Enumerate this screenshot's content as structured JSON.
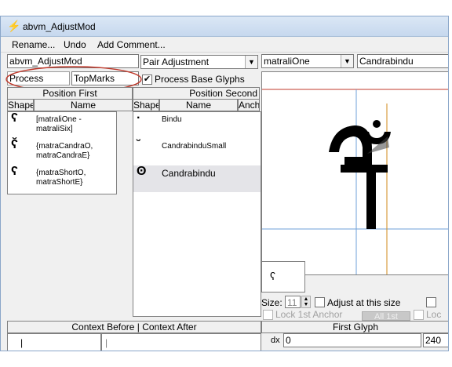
{
  "window": {
    "title": "abvm_AdjustMod",
    "icon": "lightning-icon"
  },
  "menu": {
    "items": [
      "Rename...",
      "Undo",
      "Add Comment..."
    ]
  },
  "left_panel": {
    "name_field": "abvm_AdjustMod",
    "process_label": "Process",
    "process_value": "TopMarks",
    "adjustment_type": "Pair Adjustment",
    "process_base_glyphs_label": "Process Base Glyphs",
    "process_base_glyphs_checked": true
  },
  "position_first": {
    "title": "Position First",
    "columns": [
      "Shape",
      "Name"
    ],
    "rows": [
      {
        "glyph": "ʕ",
        "name": "[matraliOne - matraliSix]"
      },
      {
        "glyph": "ʕ̆",
        "name": "{matraCandraO, matraCandraE}"
      },
      {
        "glyph": "ʕ",
        "name": "{matraShortO, matraShortE}"
      }
    ]
  },
  "position_second": {
    "title": "Position Second",
    "columns": [
      "Shape",
      "Name",
      "Anch"
    ],
    "rows": [
      {
        "glyph": "·",
        "name": "Bindu"
      },
      {
        "glyph": "˘",
        "name": "CandrabinduSmall"
      },
      {
        "glyph": "ʘ",
        "name": "Candrabindu"
      }
    ]
  },
  "preview": {
    "first_glyph_select": "matraliOne",
    "second_glyph_field": "Candrabindu",
    "size_label": "Size:",
    "size_value": "11",
    "adjust_label": "Adjust at this size",
    "lock_label": "Lock 1st Anchor",
    "all_button": "All 1st",
    "lock2_label": "Loc"
  },
  "bottom": {
    "context_header": "Context Before | Context After",
    "first_glyph_header": "First Glyph",
    "dx_label": "dx",
    "dx_value": "0",
    "right_value": "240"
  },
  "colors": {
    "highlight_ellipse": "#c0392b",
    "guide_blue": "#6fa0d8",
    "guide_red": "#c0392b",
    "guide_orange": "#d08a1a"
  }
}
